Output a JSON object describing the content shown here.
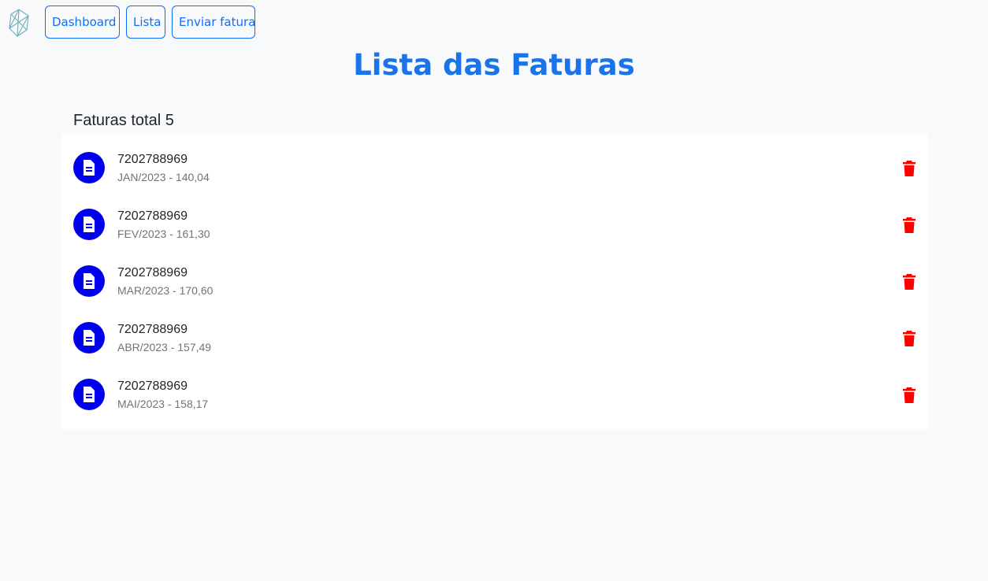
{
  "nav": {
    "logo_icon": "crystal-logo-icon",
    "buttons": [
      {
        "label": "Dashboard"
      },
      {
        "label": "Lista"
      },
      {
        "label": "Enviar fatura"
      }
    ]
  },
  "page_title": "Lista das Faturas",
  "total_label": "Faturas total 5",
  "invoices": [
    {
      "number": "7202788969",
      "detail": "JAN/2023 - 140,04",
      "icon": "document-icon",
      "action_icon": "trash-icon"
    },
    {
      "number": "7202788969",
      "detail": "FEV/2023 - 161,30",
      "icon": "document-icon",
      "action_icon": "trash-icon"
    },
    {
      "number": "7202788969",
      "detail": "MAR/2023 - 170,60",
      "icon": "document-icon",
      "action_icon": "trash-icon"
    },
    {
      "number": "7202788969",
      "detail": "ABR/2023 - 157,49",
      "icon": "document-icon",
      "action_icon": "trash-icon"
    },
    {
      "number": "7202788969",
      "detail": "MAI/2023 - 158,17",
      "icon": "document-icon",
      "action_icon": "trash-icon"
    }
  ],
  "colors": {
    "accent": "#0d6efd",
    "title": "#1a73e8",
    "icon_circle": "#0000ee",
    "delete": "#ff0000",
    "background": "#f8f9fa"
  }
}
